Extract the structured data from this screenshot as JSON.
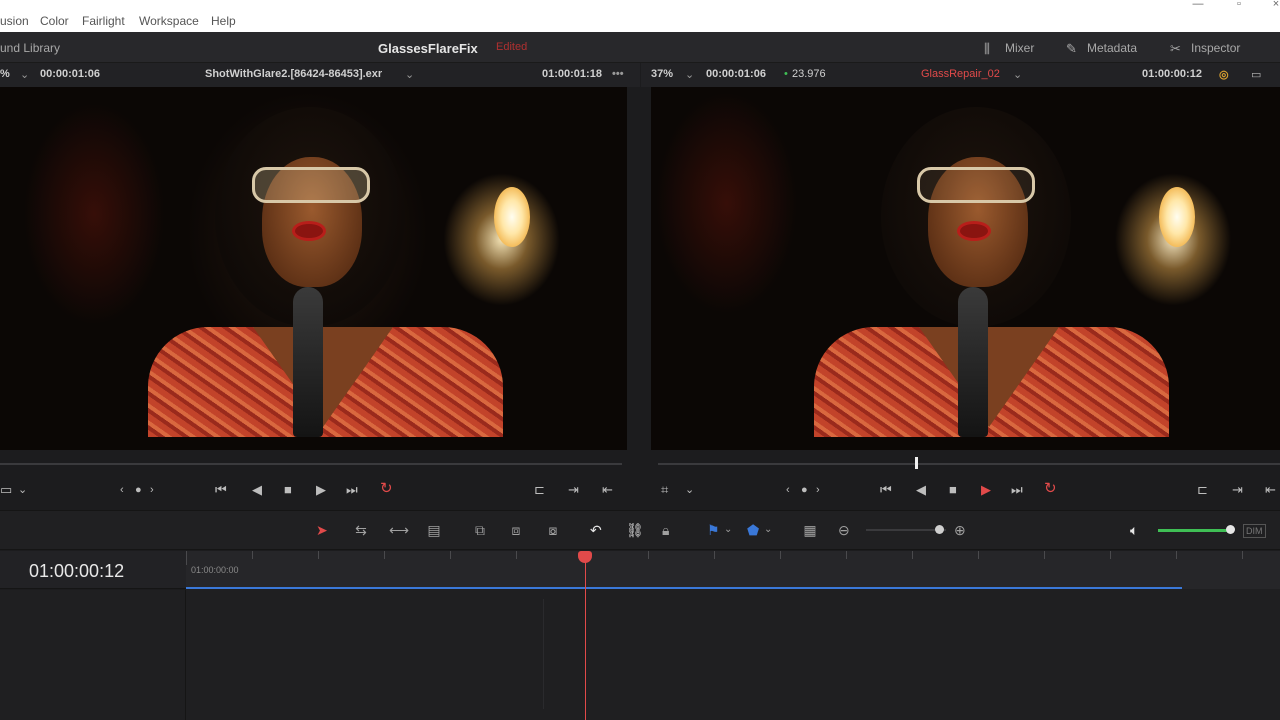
{
  "menubar": {
    "items": [
      "usion",
      "Color",
      "Fairlight",
      "Workspace",
      "Help"
    ]
  },
  "topbar": {
    "left_label": "und Library",
    "project_title": "GlassesFlareFix",
    "project_status": "Edited",
    "buttons": [
      "Mixer",
      "Metadata",
      "Inspector"
    ]
  },
  "source_viewer": {
    "zoom": "%",
    "timecode_left": "00:00:01:06",
    "clip_name": "ShotWithGlare2.[86424-86453].exr",
    "timecode_right": "01:00:01:18"
  },
  "timeline_viewer": {
    "zoom": "37%",
    "timecode_left": "00:00:01:06",
    "fps": "23.976",
    "clip_name": "GlassRepair_02",
    "timecode_right": "01:00:00:12"
  },
  "timeline": {
    "current_timecode": "01:00:00:12",
    "ruler_start": "01:00:00:00",
    "audio_button": "DIM"
  },
  "colors": {
    "accent_red": "#e14a4a",
    "accent_blue": "#3a78d8",
    "volume_green": "#3fbf55"
  }
}
